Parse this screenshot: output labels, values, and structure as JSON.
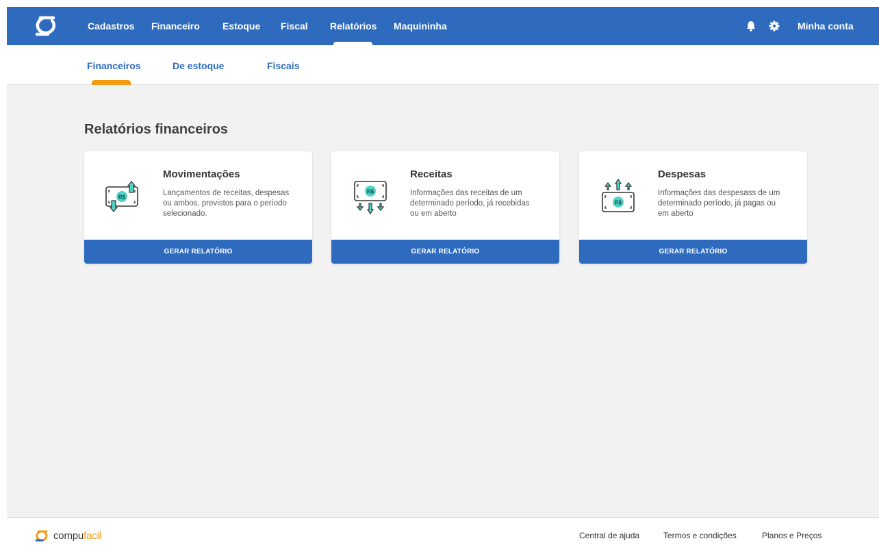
{
  "nav": {
    "logo": "compufacil-logo",
    "items": [
      {
        "label": "Cadastros"
      },
      {
        "label": "Financeiro"
      },
      {
        "label": "Estoque"
      },
      {
        "label": "Fiscal"
      },
      {
        "label": "Relatórios",
        "active": true
      },
      {
        "label": "Maquininha"
      }
    ],
    "account_label": "Minha conta",
    "icons": [
      "bell-icon",
      "gear-icon"
    ]
  },
  "subnav": {
    "tabs": [
      {
        "label": "Financeiros",
        "active": true
      },
      {
        "label": "De estoque"
      },
      {
        "label": "Fiscais"
      }
    ]
  },
  "main": {
    "title": "Relatórios financeiros",
    "cards": [
      {
        "icon": "money-exchange-icon",
        "title": "Movimentações",
        "description": "Lançamentos de receitas, despesas ou ambos, previstos para o período selecionado.",
        "button": "GERAR RELATÓRIO"
      },
      {
        "icon": "money-income-icon",
        "title": "Receitas",
        "description": "Informações das receitas de um determinado período, já recebidas ou em aberto",
        "button": "GERAR RELATÓRIO"
      },
      {
        "icon": "money-expense-icon",
        "title": "Despesas",
        "description": "Informações das despesass de um determinado período, já pagas ou em aberto",
        "button": "GERAR RELATÓRIO"
      }
    ],
    "money_symbol": "R$"
  },
  "footer": {
    "brand_main": "compu",
    "brand_accent": "facil",
    "links": [
      {
        "label": "Central de ajuda"
      },
      {
        "label": "Termos e condições"
      },
      {
        "label": "Planos e Preços"
      }
    ]
  },
  "colors": {
    "primary": "#2e6bbf",
    "accent": "#f39c12",
    "icon_teal": "#4ed4c6",
    "background": "#f2f2f2"
  }
}
